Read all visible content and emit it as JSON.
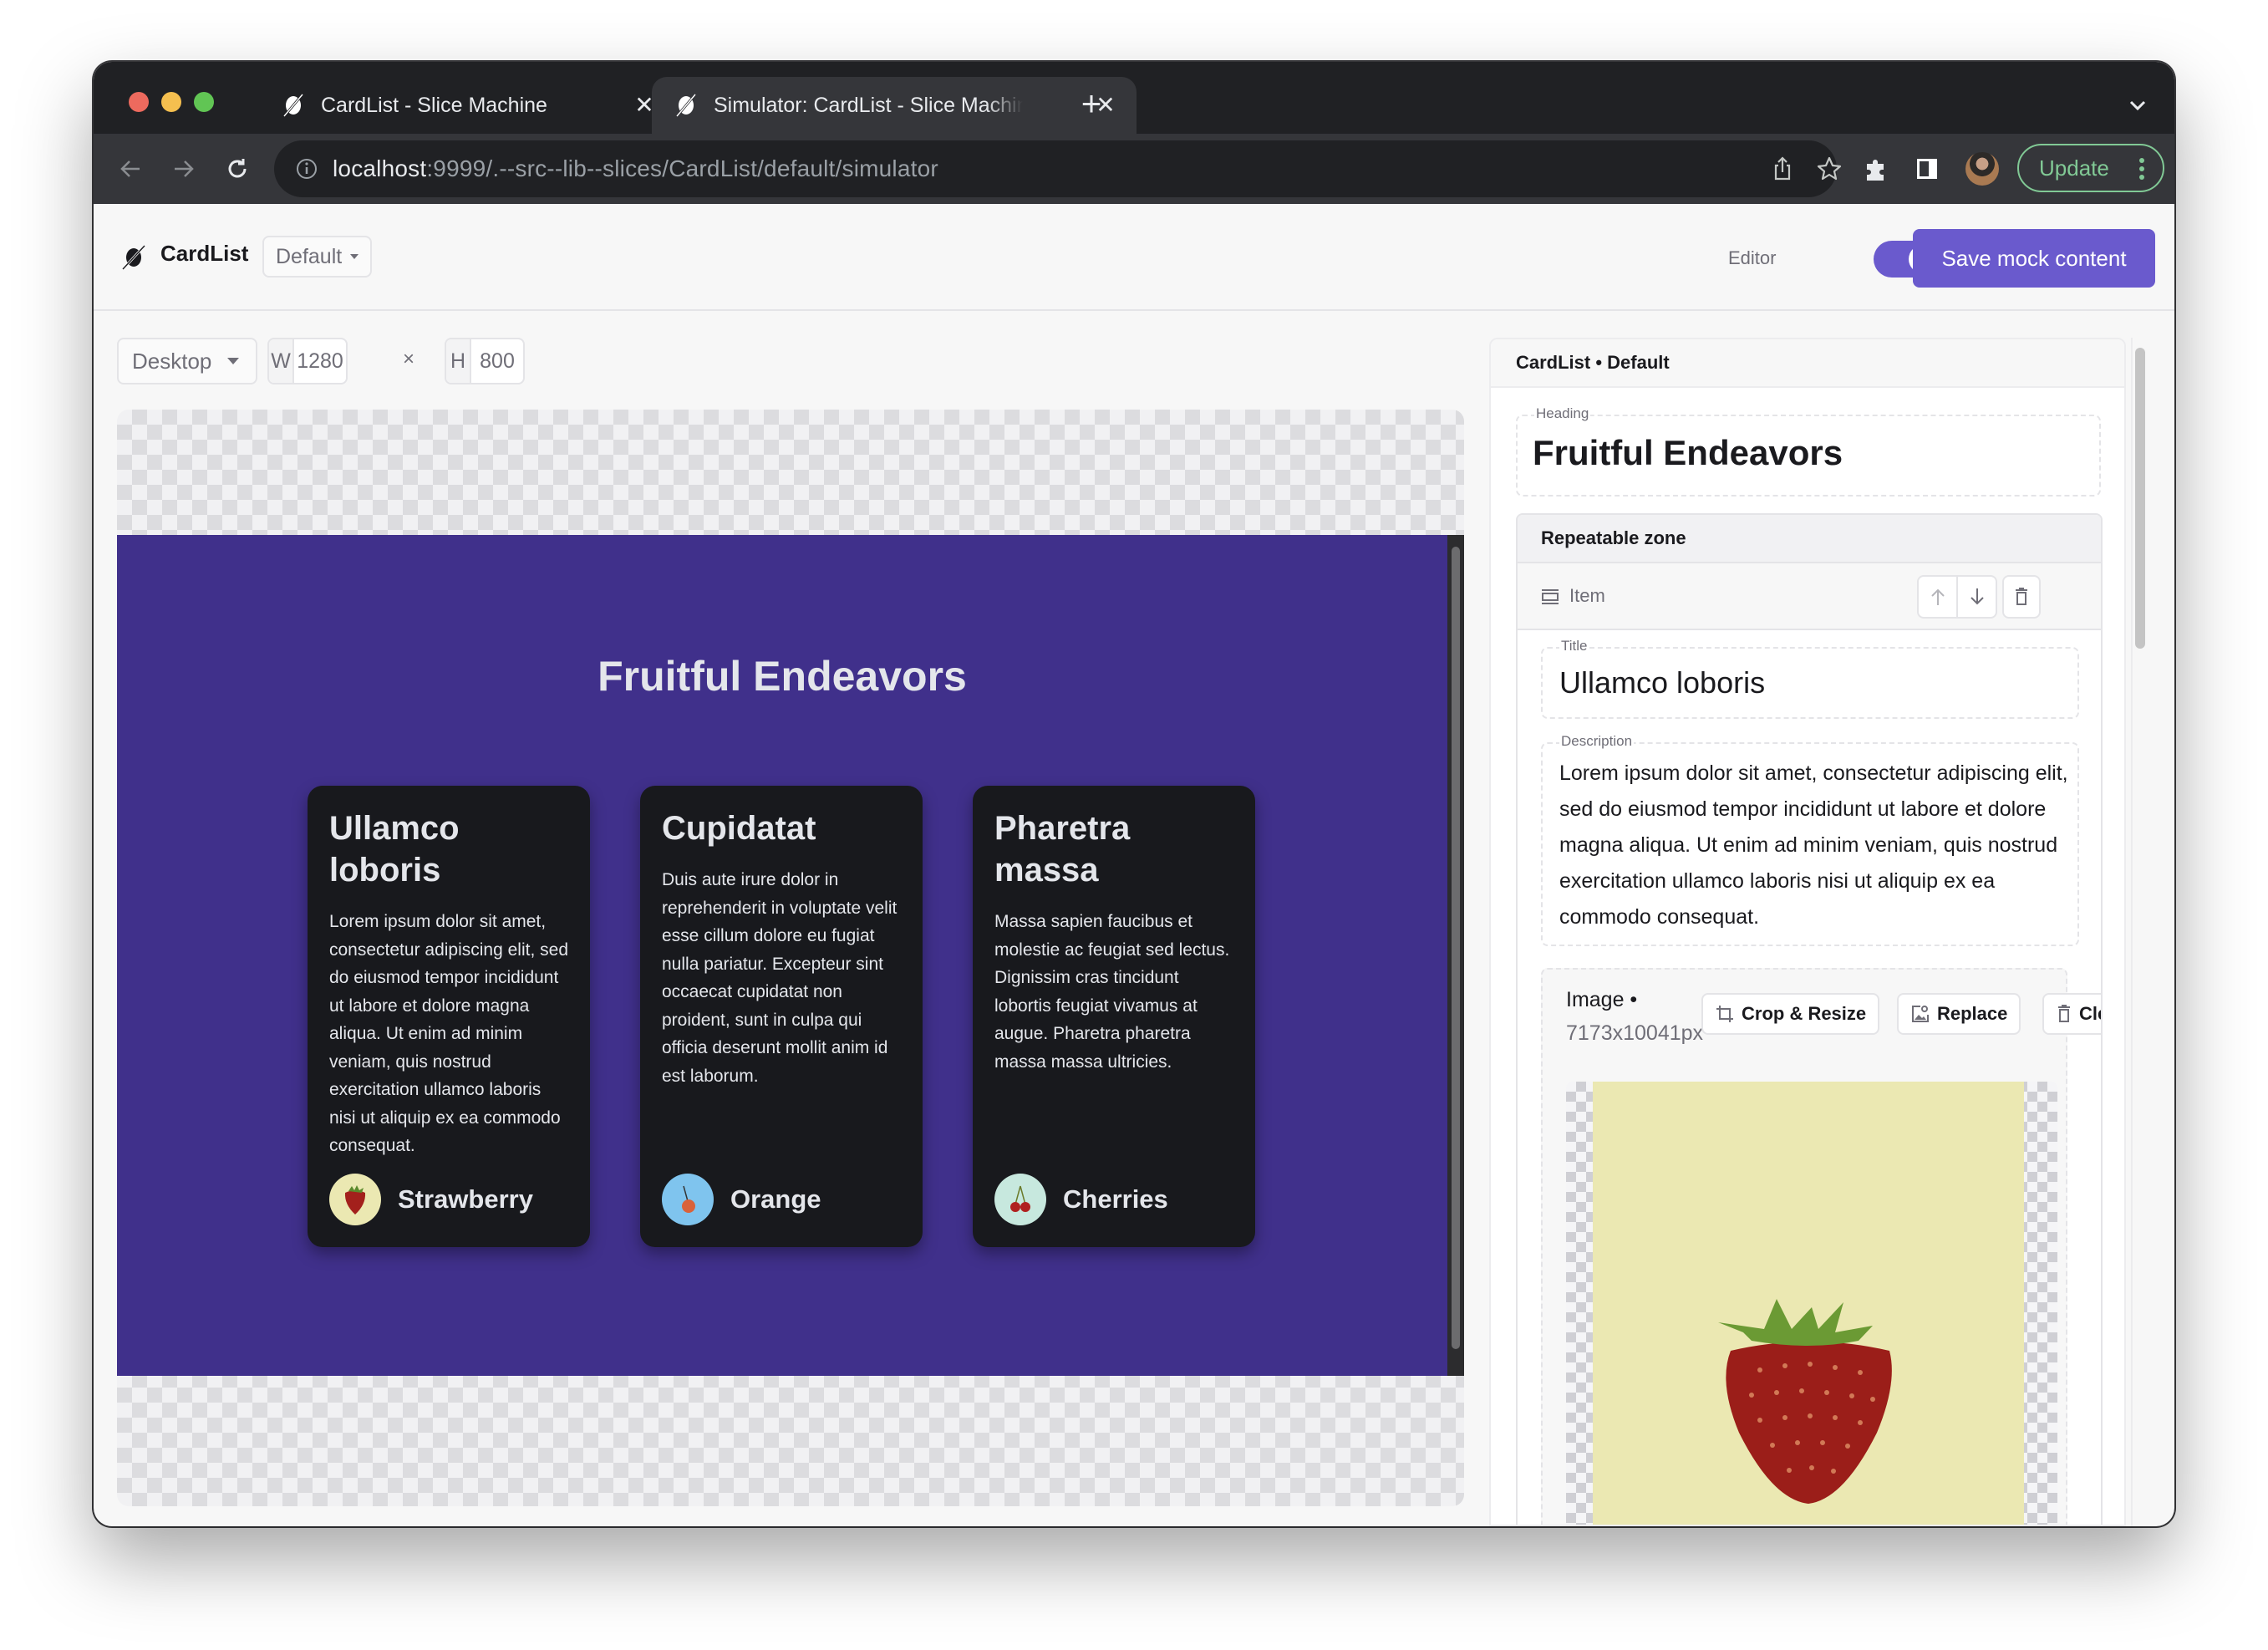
{
  "browser": {
    "tabs": [
      {
        "title": "CardList - Slice Machine",
        "active": false
      },
      {
        "title": "Simulator: CardList - Slice Machine",
        "active": true
      }
    ],
    "url_host": "localhost",
    "url_rest": ":9999/.--src--lib--slices/CardList/default/simulator",
    "update_label": "Update"
  },
  "app_header": {
    "slice_name": "CardList",
    "variation": "Default",
    "editor_label": "Editor",
    "editor_enabled": true,
    "save_label": "Save mock content"
  },
  "simulator_controls": {
    "screen": "Desktop",
    "width_label": "W",
    "width": "1280",
    "times": "×",
    "height_label": "H",
    "height": "800"
  },
  "preview": {
    "heading": "Fruitful Endeavors",
    "cards": [
      {
        "title": "Ullamco loboris",
        "description": "Lorem ipsum dolor sit amet, consectetur adipiscing elit, sed do eiusmod tempor incididunt ut labore et dolore magna aliqua. Ut enim ad minim veniam, quis nostrud exercitation ullamco laboris nisi ut aliquip ex ea commodo consequat.",
        "fruit": "Strawberry",
        "fruit_bg": "#ebe8b2"
      },
      {
        "title": "Cupidatat",
        "description": "Duis aute irure dolor in reprehenderit in voluptate velit esse cillum dolore eu fugiat nulla pariatur. Excepteur sint occaecat cupidatat non proident, sunt in culpa qui officia deserunt mollit anim id est laborum.",
        "fruit": "Orange",
        "fruit_bg": "#7fc4ee"
      },
      {
        "title": "Pharetra massa",
        "description": "Massa sapien faucibus et molestie ac feugiat sed lectus. Dignissim cras tincidunt lobortis feugiat vivamus at augue. Pharetra pharetra massa massa ultricies.",
        "fruit": "Cherries",
        "fruit_bg": "#c7e8de"
      }
    ],
    "background_color": "#40308b"
  },
  "editor_panel": {
    "breadcrumb": "CardList • Default",
    "heading_label": "Heading",
    "heading_value": "Fruitful Endeavors",
    "repeatable_zone_label": "Repeatable zone",
    "item_label": "Item",
    "title_label": "Title",
    "title_value": "Ullamco loboris",
    "description_label": "Description",
    "description_value": "Lorem ipsum dolor sit amet, consectetur adipiscing elit, sed do eiusmod tempor incididunt ut labore et dolore magna aliqua. Ut enim ad minim veniam, quis nostrud exercitation ullamco laboris nisi ut aliquip ex ea commodo consequat.",
    "image_label": "Image •",
    "image_dimensions": "7173x10041px",
    "crop_label": "Crop & Resize",
    "replace_label": "Replace",
    "clear_label": "Clear"
  },
  "colors": {
    "accent": "#6a5acd",
    "update_green": "#81c995"
  }
}
